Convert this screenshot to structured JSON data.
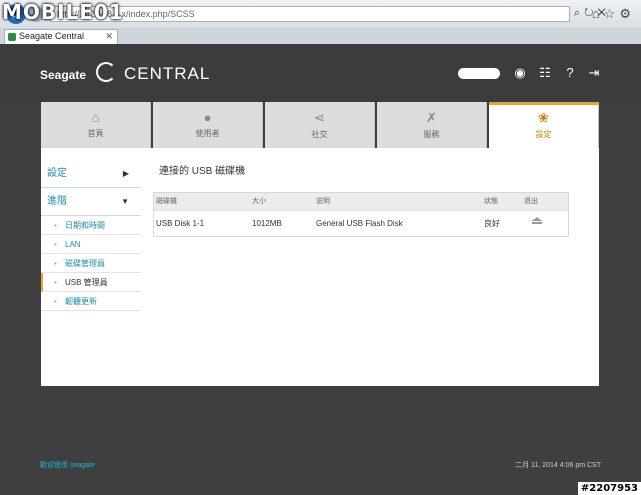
{
  "browser": {
    "url": "http://192.168.x.x/index.php/SCSS",
    "tab_title": "Seagate Central",
    "watermark": "MOBILE01"
  },
  "header": {
    "brand": "Seagate",
    "product": "CENTRAL"
  },
  "nav_tabs": [
    {
      "label": "首頁",
      "icon": "home-icon"
    },
    {
      "label": "使用者",
      "icon": "user-icon"
    },
    {
      "label": "社交",
      "icon": "share-icon"
    },
    {
      "label": "服務",
      "icon": "tools-icon"
    },
    {
      "label": "設定",
      "icon": "settings-icon",
      "active": true
    }
  ],
  "sidebar": {
    "section1": "設定",
    "section2": "進階",
    "items": [
      {
        "label": "日期和時間"
      },
      {
        "label": "LAN"
      },
      {
        "label": "磁碟管理員"
      },
      {
        "label": "USB 管理員",
        "active": true
      },
      {
        "label": "韌體更新"
      }
    ]
  },
  "content": {
    "title": "連接的 USB 磁碟機",
    "columns": [
      "磁碟機",
      "大小",
      "说明",
      "狀態",
      "退出"
    ],
    "rows": [
      {
        "drive": "USB Disk 1-1",
        "size": "1012MB",
        "description": "General USB Flash Disk",
        "status": "良好"
      }
    ]
  },
  "footer": {
    "left": "歡迎使用 seagate",
    "right": "二月 11, 2014 4:06 pm CST",
    "badge": "#2207953"
  },
  "colors": {
    "accent": "#e8a33a",
    "link": "#1d8fa7",
    "header_bg": "#3c3c3c"
  }
}
